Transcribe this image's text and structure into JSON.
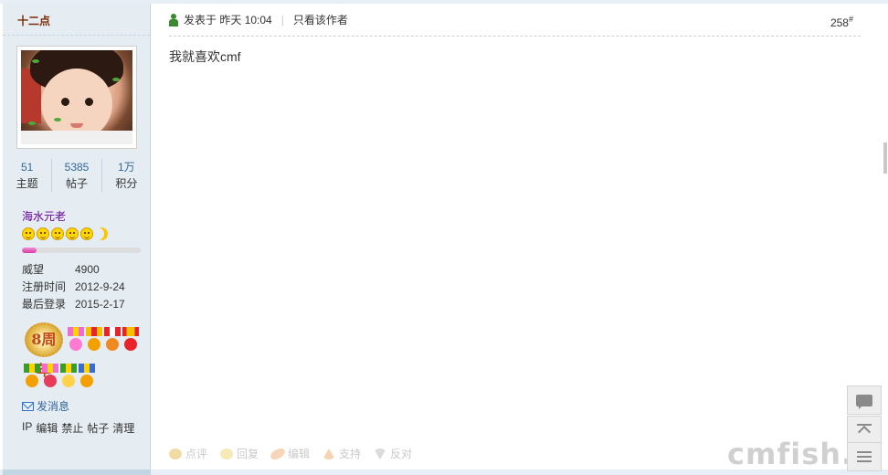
{
  "user": {
    "name": "十二点",
    "stats": [
      {
        "value": "51",
        "label": "主题"
      },
      {
        "value": "5385",
        "label": "帖子"
      },
      {
        "value": "1万",
        "label": "积分"
      }
    ],
    "rank": "海水元老",
    "level_progress": 0.12,
    "info": [
      {
        "key": "威望",
        "value": "4900"
      },
      {
        "key": "注册时间",
        "value": "2012-9-24"
      },
      {
        "key": "最后登录",
        "value": "2015-2-17"
      }
    ],
    "medal_8_text": "8周年",
    "send_message": "发消息",
    "mod_links": [
      "IP",
      "编辑",
      "禁止",
      "帖子",
      "清理"
    ]
  },
  "post": {
    "posted_prefix": "发表于",
    "posted_time": "昨天 10:04",
    "only_author": "只看该作者",
    "floor": "258",
    "floor_mark": "#",
    "content": "我就喜欢cmf",
    "actions": [
      "点评",
      "回复",
      "编辑",
      "支持",
      "反对"
    ]
  },
  "watermark": "cmfish.com",
  "colors": {
    "sidebar_bg": "#e5edf2",
    "border": "#c2d5e3",
    "username": "#7b2a06",
    "rank": "#660099",
    "link": "#336699"
  }
}
